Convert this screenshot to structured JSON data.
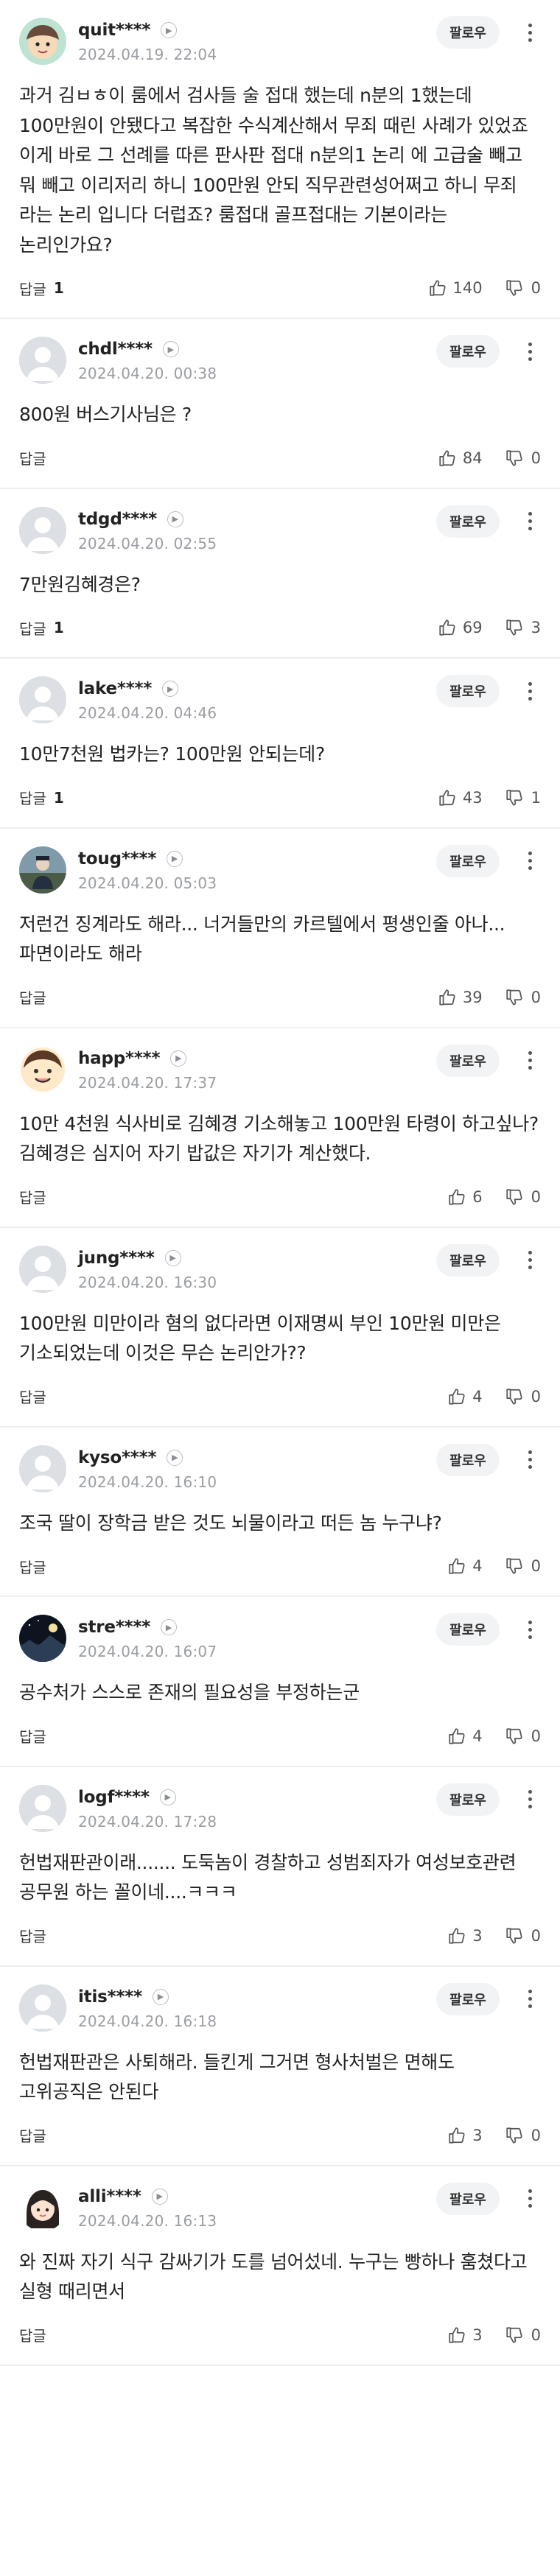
{
  "follow_label": "팔로우",
  "reply_label": "답글",
  "colors": {
    "accent_green": "#4fb13b",
    "meta_gray": "#9a9da2",
    "divider": "#eceef0"
  },
  "comments": [
    {
      "username": "quit****",
      "date": "2024.04.19. 22:04",
      "avatar": "cartoon-face-avatar",
      "text": "과거 김ㅂㅎ이 룸에서 검사들 술 접대 했는데 n분의 1했는데 100만원이 안됐다고 복잡한 수식계산해서 무죄 때린 사례가 있었죠 이게 바로 그 선례를 따른 판사판 접대 n분의1 논리 에 고급술 빼고 뭐 빼고 이리저리 하니 100만원 안되 직무관련성어쩌고 하니 무죄 라는 논리 입니다 더럽죠? 룸접대 골프접대는 기본이라는 논리인가요?",
      "reply_count": "1",
      "likes": "140",
      "dislikes": "0"
    },
    {
      "username": "chdl****",
      "date": "2024.04.20. 00:38",
      "avatar": "default-avatar",
      "text": "800원 버스기사님은 ?",
      "reply_count": "",
      "likes": "84",
      "dislikes": "0"
    },
    {
      "username": "tdgd****",
      "date": "2024.04.20. 02:55",
      "avatar": "default-avatar",
      "text": "7만원김혜경은?",
      "reply_count": "1",
      "likes": "69",
      "dislikes": "3"
    },
    {
      "username": "lake****",
      "date": "2024.04.20. 04:46",
      "avatar": "default-avatar",
      "text": "10만7천원 법카는? 100만원 안되는데?",
      "reply_count": "1",
      "likes": "43",
      "dislikes": "1"
    },
    {
      "username": "toug****",
      "date": "2024.04.20. 05:03",
      "avatar": "photo-avatar",
      "text": "저런건 징계라도 해라... 너거들만의 카르텔에서 평생인줄 아나... 파면이라도 해라",
      "reply_count": "",
      "likes": "39",
      "dislikes": "0"
    },
    {
      "username": "happ****",
      "date": "2024.04.20. 17:37",
      "avatar": "smiley-avatar",
      "text": "10만 4천원 식사비로 김혜경 기소해놓고 100만원 타령이 하고싶나? 김혜경은 심지어 자기 밥값은 자기가 계산했다.",
      "reply_count": "",
      "likes": "6",
      "dislikes": "0"
    },
    {
      "username": "jung****",
      "date": "2024.04.20. 16:30",
      "avatar": "default-avatar",
      "text": "100만원 미만이라 혐의 없다라면 이재명씨 부인 10만원 미만은 기소되었는데 이것은 무슨 논리안가??",
      "reply_count": "",
      "likes": "4",
      "dislikes": "0"
    },
    {
      "username": "kyso****",
      "date": "2024.04.20. 16:10",
      "avatar": "default-avatar",
      "text": "조국 딸이 장학금 받은 것도 뇌물이라고 떠든 놈 누구냐?",
      "reply_count": "",
      "likes": "4",
      "dislikes": "0"
    },
    {
      "username": "stre****",
      "date": "2024.04.20. 16:07",
      "avatar": "night-photo-avatar",
      "text": "공수처가 스스로 존재의 필요성을 부정하는군",
      "reply_count": "",
      "likes": "4",
      "dislikes": "0"
    },
    {
      "username": "logf****",
      "date": "2024.04.20. 17:28",
      "avatar": "default-avatar",
      "text": "헌법재판관이래....... 도둑놈이 경찰하고 성범죄자가 여성보호관련 공무원 하는 꼴이네....ㅋㅋㅋ",
      "reply_count": "",
      "likes": "3",
      "dislikes": "0"
    },
    {
      "username": "itis****",
      "date": "2024.04.20. 16:18",
      "avatar": "default-avatar",
      "text": "헌법재판관은 사퇴해라. 들킨게 그거면 형사처벌은 면해도 고위공직은 안된다",
      "reply_count": "",
      "likes": "3",
      "dislikes": "0"
    },
    {
      "username": "alli****",
      "date": "2024.04.20. 16:13",
      "avatar": "girl-avatar",
      "text": "와 진짜 자기 식구 감싸기가 도를 넘어섰네. 누구는 빵하나 훔쳤다고 실형 때리면서",
      "reply_count": "",
      "likes": "3",
      "dislikes": "0"
    }
  ]
}
